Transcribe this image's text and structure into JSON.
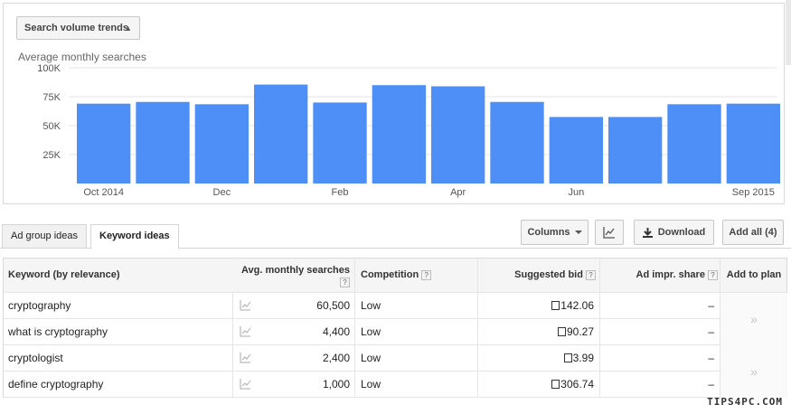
{
  "trend_select": {
    "label": "Search volume trends"
  },
  "chart_data": {
    "type": "bar",
    "title": "Average monthly searches",
    "categories": [
      "Oct 2014",
      "Nov 2014",
      "Dec 2014",
      "Jan 2015",
      "Feb 2015",
      "Mar 2015",
      "Apr 2015",
      "May 2015",
      "Jun 2015",
      "Jul 2015",
      "Aug 2015",
      "Sep 2015"
    ],
    "x_tick_labels": [
      "Oct 2014",
      "",
      "Dec",
      "",
      "Feb",
      "",
      "Apr",
      "",
      "Jun",
      "",
      "",
      "Sep 2015"
    ],
    "values": [
      69000,
      70500,
      68500,
      85500,
      70000,
      85000,
      84000,
      70500,
      57500,
      57500,
      68500,
      69000
    ],
    "y_ticks": [
      25000,
      50000,
      75000,
      100000
    ],
    "y_tick_labels": [
      "25K",
      "50K",
      "75K",
      "100K"
    ],
    "ylim": [
      0,
      100000
    ],
    "grid": true,
    "legend": "none",
    "bar_color": "#4d8ff6"
  },
  "tabs": [
    {
      "label": "Ad group ideas",
      "active": false
    },
    {
      "label": "Keyword ideas",
      "active": true
    }
  ],
  "toolbar": {
    "columns_label": "Columns",
    "download_label": "Download",
    "add_all_label": "Add all (4)"
  },
  "table": {
    "headers": {
      "keyword": "Keyword (by relevance)",
      "searches": "Avg. monthly searches",
      "competition": "Competition",
      "bid": "Suggested bid",
      "impr": "Ad impr. share",
      "plan": "Add to plan"
    },
    "help": "?",
    "rows": [
      {
        "keyword": "cryptography",
        "searches": "60,500",
        "competition": "Low",
        "bid": "142.06",
        "impr": "–"
      },
      {
        "keyword": "what is cryptography",
        "searches": "4,400",
        "competition": "Low",
        "bid": "90.27",
        "impr": "–"
      },
      {
        "keyword": "cryptologist",
        "searches": "2,400",
        "competition": "Low",
        "bid": "3.99",
        "impr": "–"
      },
      {
        "keyword": "define cryptography",
        "searches": "1,000",
        "competition": "Low",
        "bid": "306.74",
        "impr": "–"
      }
    ],
    "plan_symbol": "»"
  },
  "watermark": "TIPS4PC.COM"
}
